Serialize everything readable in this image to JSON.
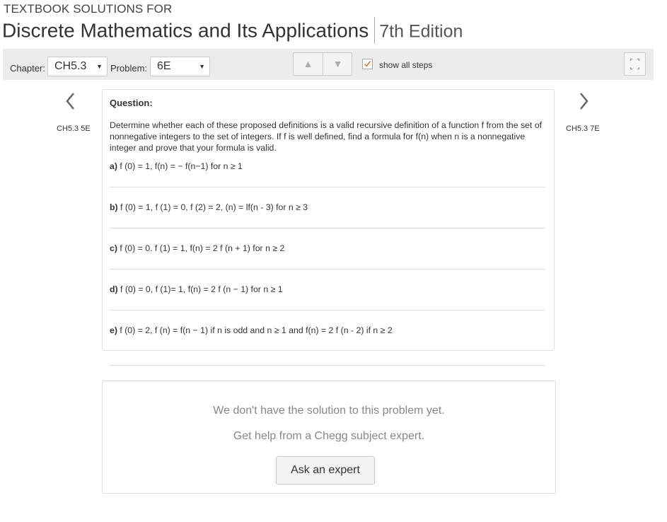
{
  "header": {
    "pretitle": "TEXTBOOK SOLUTIONS FOR",
    "book_title": "Discrete Mathematics and Its Applications",
    "edition": "7th Edition"
  },
  "toolbar": {
    "chapter_label": "Chapter:",
    "chapter_value": "CH5.3",
    "problem_label": "Problem:",
    "problem_value": "6E",
    "up_arrow": "▲",
    "down_arrow": "▼",
    "show_steps_label": "show all steps",
    "show_steps_checked": true
  },
  "nav": {
    "prev_label": "CH5.3 5E",
    "next_label": "CH5.3 7E"
  },
  "question": {
    "heading": "Question:",
    "text": "Determine whether each of these proposed definitions is a valid recursive definition of a function f from the set of nonnegative integers to the set of integers. If f is well defined, find a formula for f(n) when n is a nonnegative integer and prove that your formula is valid.",
    "parts": [
      {
        "label": "a)",
        "text": "f (0) = 1, f(n) = − f(n−1) for n ≥ 1"
      },
      {
        "label": "b)",
        "text": "f (0) = 1, f (1) = 0, f (2) = 2, (n) = lf(n - 3) for n ≥ 3"
      },
      {
        "label": "c)",
        "text": "f (0) = 0. f (1) = 1, f(n) = 2 f (n + 1) for n ≥ 2"
      },
      {
        "label": "d)",
        "text": "f (0) = 0, f (1)= 1, f(n) = 2 f (n − 1) for n ≥ 1"
      },
      {
        "label": "e)",
        "text": "f (0) = 2, f (n) = f(n − 1) if n is odd and n ≥ 1 and f(n) = 2 f (n - 2) if n ≥ 2"
      }
    ]
  },
  "answer": {
    "no_solution": "We don't have the solution to this problem yet.",
    "help_text": "Get help from a Chegg subject expert.",
    "ask_button": "Ask an expert"
  },
  "colors": {
    "toolbar_bg": "#ececec",
    "checkmark": "#e87722",
    "border": "#dddddd"
  }
}
